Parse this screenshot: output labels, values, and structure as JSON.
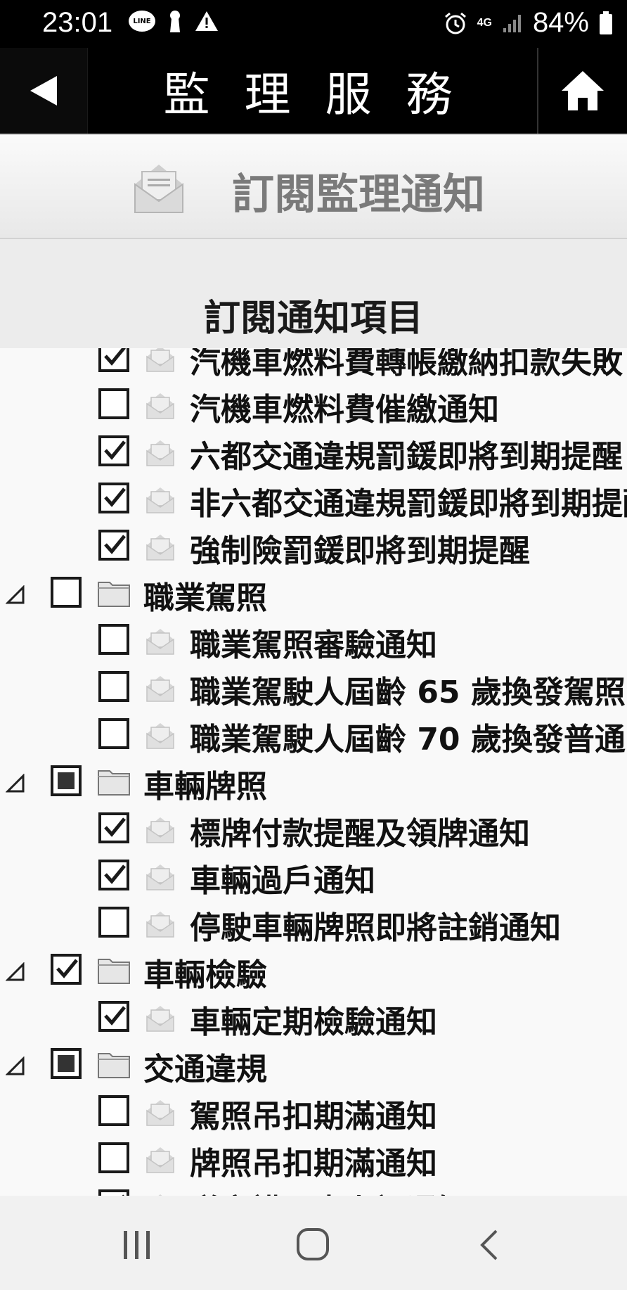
{
  "status_bar": {
    "time": "23:01",
    "line_badge": "LINE",
    "network": "4G",
    "battery": "84%",
    "icons": [
      "line-icon",
      "keyhole-icon",
      "warning-icon",
      "alarm-icon",
      "network-4g-icon",
      "signal-icon",
      "battery-icon"
    ]
  },
  "header": {
    "title": "監 理 服 務",
    "back_icon": "back-arrow-icon",
    "home_icon": "home-icon"
  },
  "subscribe": {
    "title": "訂閱監理通知",
    "icon": "envelope-icon"
  },
  "section": {
    "title": "訂閱通知項目"
  },
  "tree": [
    {
      "type": "leaf",
      "label": "汽機車燃料費轉帳繳納扣款失敗",
      "state": "checked"
    },
    {
      "type": "leaf",
      "label": "汽機車燃料費催繳通知",
      "state": "unchecked"
    },
    {
      "type": "leaf",
      "label": "六都交通違規罰鍰即將到期提醒",
      "state": "checked"
    },
    {
      "type": "leaf",
      "label": "非六都交通違規罰鍰即將到期提醒",
      "state": "checked"
    },
    {
      "type": "leaf",
      "label": "強制險罰鍰即將到期提醒",
      "state": "checked"
    },
    {
      "type": "category",
      "label": "職業駕照",
      "state": "unchecked"
    },
    {
      "type": "leaf",
      "label": "職業駕照審驗通知",
      "state": "unchecked"
    },
    {
      "type": "leaf",
      "label": "職業駕駛人屆齡 65 歲換發駕照",
      "state": "unchecked"
    },
    {
      "type": "leaf",
      "label": "職業駕駛人屆齡 70 歲換發普通",
      "state": "unchecked"
    },
    {
      "type": "category",
      "label": "車輛牌照",
      "state": "partial"
    },
    {
      "type": "leaf",
      "label": "標牌付款提醒及領牌通知",
      "state": "checked"
    },
    {
      "type": "leaf",
      "label": "車輛過戶通知",
      "state": "checked"
    },
    {
      "type": "leaf",
      "label": "停駛車輛牌照即將註銷通知",
      "state": "unchecked"
    },
    {
      "type": "category",
      "label": "車輛檢驗",
      "state": "checked"
    },
    {
      "type": "leaf",
      "label": "車輛定期檢驗通知",
      "state": "checked"
    },
    {
      "type": "category",
      "label": "交通違規",
      "state": "partial"
    },
    {
      "type": "leaf",
      "label": "駕照吊扣期滿通知",
      "state": "unchecked"
    },
    {
      "type": "leaf",
      "label": "牌照吊扣期滿通知",
      "state": "unchecked"
    },
    {
      "type": "leaf",
      "label": "道安講習未上課通知",
      "state": "checked"
    }
  ],
  "nav": {
    "icons": [
      "recent-apps-icon",
      "home-circle-icon",
      "back-chevron-icon"
    ]
  }
}
